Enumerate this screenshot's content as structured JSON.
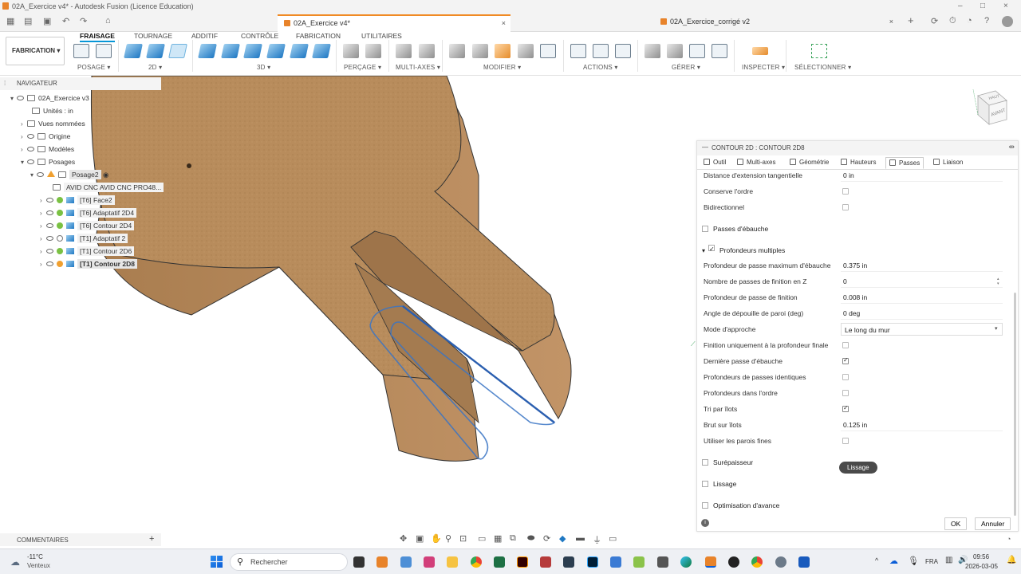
{
  "window": {
    "title": "02A_Exercice v4* - Autodesk Fusion (Licence Education)",
    "controls": [
      "–",
      "□",
      "×"
    ]
  },
  "tabs": [
    {
      "label": "02A_Exercice v4*",
      "active": true
    },
    {
      "label": "02A_Exercice_corrigé v2",
      "active": false
    }
  ],
  "ribbon": {
    "workspace": "FABRICATION",
    "tabs": [
      "FRAISAGE",
      "TOURNAGE",
      "ADDITIF",
      "CONTRÔLE",
      "FABRICATION",
      "UTILITAIRES"
    ],
    "active_tab": "FRAISAGE",
    "groups": [
      "POSAGE",
      "2D",
      "3D",
      "PERÇAGE",
      "MULTI-AXES",
      "MODIFIER",
      "ACTIONS",
      "GÉRER",
      "INSPECTER",
      "SÉLECTIONNER"
    ]
  },
  "navigator": {
    "header": "NAVIGATEUR",
    "root": "02A_Exercice v3",
    "units": "Unités : in",
    "named_views": "Vues nommées",
    "origin": "Origine",
    "models": "Modèles",
    "setups": "Posages",
    "setup": "Posage2",
    "machine": "AVID CNC AVID CNC PRO48...",
    "operations": [
      {
        "label": "[T6] Face2",
        "status": "ok"
      },
      {
        "label": "[T6] Adaptatif 2D4",
        "status": "ok"
      },
      {
        "label": "[T6] Contour 2D4",
        "status": "ok"
      },
      {
        "label": "[T1] Adaptatif 2",
        "status": "suppressed"
      },
      {
        "label": "[T1] Contour 2D6",
        "status": "ok"
      },
      {
        "label": "[T1] Contour 2D8",
        "status": "edit"
      }
    ]
  },
  "panel": {
    "title": "CONTOUR 2D : CONTOUR 2D8",
    "tabs": [
      "Outil",
      "Multi-axes",
      "Géométrie",
      "Hauteurs",
      "Passes",
      "Liaison"
    ],
    "active_tab": "Passes",
    "rows_top": [
      {
        "label": "Distance d'extension tangentielle",
        "value": "0 in"
      },
      {
        "label": "Conserve l'ordre",
        "checked": false
      },
      {
        "label": "Bidirectionnel",
        "checked": false
      }
    ],
    "section_roughing": "Passes d'ébauche",
    "section_multi": "Profondeurs multiples",
    "rows_multi": [
      {
        "label": "Profondeur de passe maximum d'ébauche",
        "value": "0.375 in"
      },
      {
        "label": "Nombre de passes de finition en Z",
        "value": "0"
      },
      {
        "label": "Profondeur de passe de finition",
        "value": "0.008 in"
      },
      {
        "label": "Angle de dépouille de paroi (deg)",
        "value": "0 deg"
      },
      {
        "label": "Mode d'approche",
        "value": "Le long du mur"
      },
      {
        "label": "Finition uniquement à la profondeur finale",
        "checked": false
      },
      {
        "label": "Dernière passe d'ébauche",
        "checked": true
      },
      {
        "label": "Profondeurs de passes identiques",
        "checked": false
      },
      {
        "label": "Profondeurs dans l'ordre",
        "checked": false
      },
      {
        "label": "Tri par îlots",
        "checked": true
      },
      {
        "label": "Brut sur îlots",
        "value": "0.125 in"
      },
      {
        "label": "Utiliser les parois fines",
        "checked": false
      }
    ],
    "section_stock": "Surépaisseur",
    "section_smoothing": "Lissage",
    "section_feed": "Optimisation d'avance",
    "tooltip": "Lissage",
    "ok": "OK",
    "cancel": "Annuler"
  },
  "viewcube": {
    "top": "HAUT",
    "front": "AVANT"
  },
  "comments": "COMMENTAIRES",
  "taskbar": {
    "weather_temp": "-11°C",
    "weather_desc": "Venteux",
    "search": "Rechercher",
    "lang": "FRA",
    "time": "09:56",
    "date": "2026-03-05"
  },
  "colors": {
    "accent": "#0696d7",
    "tab_accent": "#f08a24",
    "wood": "#b98d5e",
    "toolpath": "#3a74c4"
  }
}
